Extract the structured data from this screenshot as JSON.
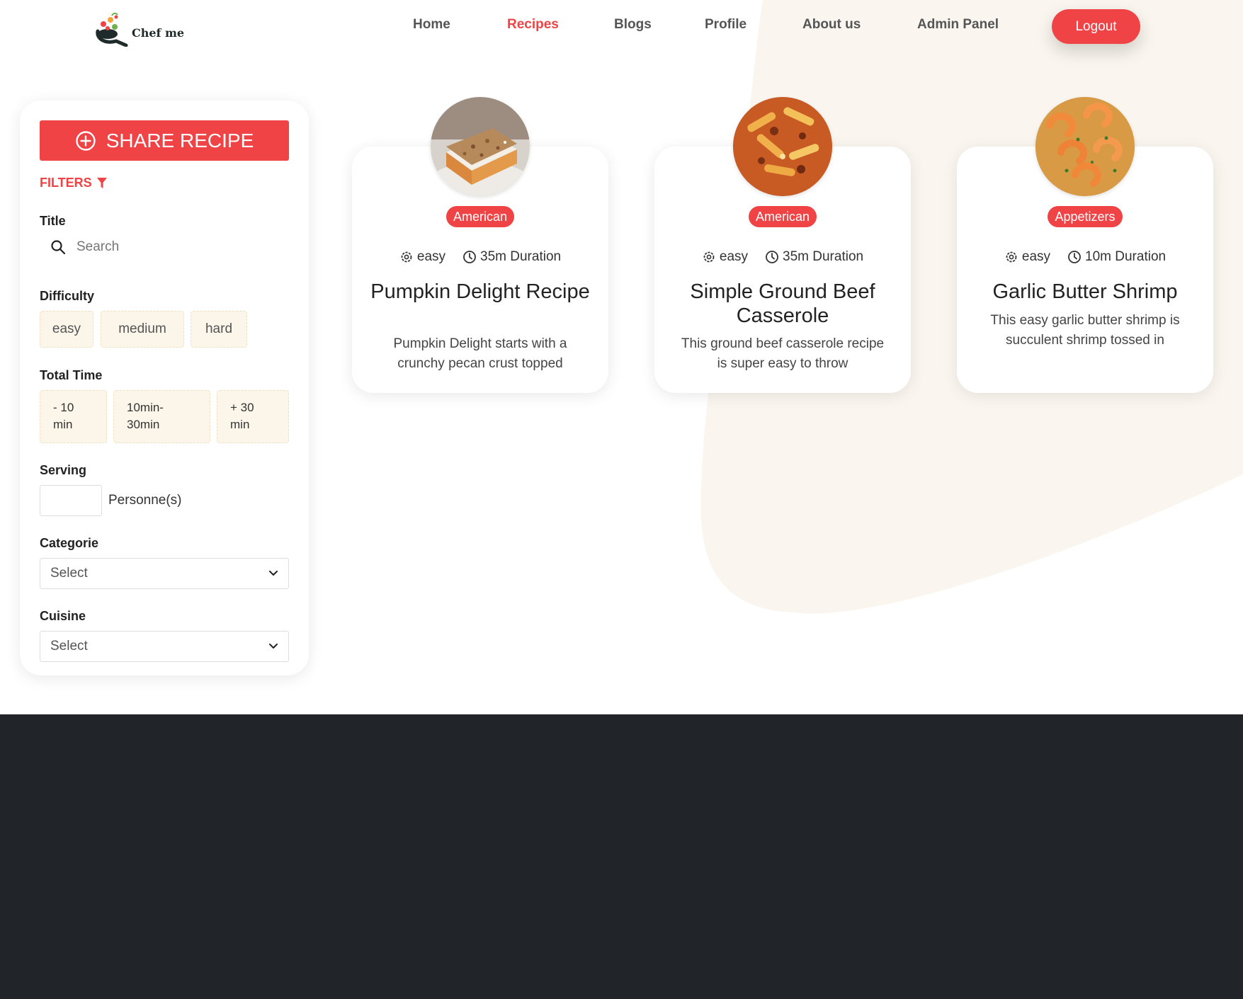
{
  "brand": {
    "name": "Chef me"
  },
  "nav": {
    "items": [
      {
        "label": "Home"
      },
      {
        "label": "Recipes"
      },
      {
        "label": "Blogs"
      },
      {
        "label": "Profile"
      },
      {
        "label": "About us"
      },
      {
        "label": "Admin Panel"
      }
    ],
    "active": "Recipes",
    "logout_label": "Logout"
  },
  "sidebar": {
    "share_label": "SHARE RECIPE",
    "filters_label": "FILTERS",
    "title_label": "Title",
    "search_placeholder": "Search",
    "difficulty_label": "Difficulty",
    "difficulty_options": [
      "easy",
      "medium",
      "hard"
    ],
    "total_time_label": "Total Time",
    "time_options": [
      {
        "line1": "- 10",
        "line2": "min"
      },
      {
        "line1": "10min-",
        "line2": "30min"
      },
      {
        "line1": "+ 30",
        "line2": "min"
      }
    ],
    "serving_label": "Serving",
    "serving_unit": "Personne(s)",
    "categorie_label": "Categorie",
    "categorie_value": "Select",
    "cuisine_label": "Cuisine",
    "cuisine_value": "Select"
  },
  "recipes": [
    {
      "tag": "American",
      "difficulty": "easy",
      "duration": "35m Duration",
      "title": "Pumpkin Delight Recipe",
      "description": "Pumpkin Delight starts with a crunchy pecan crust topped"
    },
    {
      "tag": "American",
      "difficulty": "easy",
      "duration": "35m Duration",
      "title": "Simple Ground Beef Casserole",
      "description": "This ground beef casserole recipe is super easy to throw"
    },
    {
      "tag": "Appetizers",
      "difficulty": "easy",
      "duration": "10m Duration",
      "title": "Garlic Butter Shrimp",
      "description": "This easy garlic butter shrimp is succulent shrimp tossed in"
    }
  ],
  "colors": {
    "accent": "#ef4346",
    "chip_bg": "#fbf5ea",
    "blob_bg": "#faf6ef",
    "footer_bg": "#212429"
  },
  "icons": {
    "logo": "chef-pan-logo-icon",
    "share": "plus-circle-icon",
    "filters": "funnel-icon",
    "search": "search-icon",
    "select": "chevron-down-icon",
    "difficulty": "gear-icon",
    "duration": "clock-icon"
  }
}
